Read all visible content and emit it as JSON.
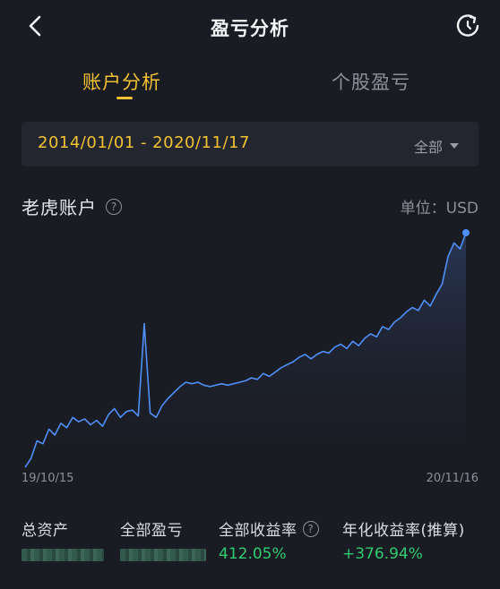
{
  "header": {
    "title": "盈亏分析"
  },
  "tabs": [
    {
      "label": "账户分析",
      "active": true
    },
    {
      "label": "个股盈亏",
      "active": false
    }
  ],
  "date_filter": {
    "range": "2014/01/01 - 2020/11/17",
    "scope": "全部"
  },
  "account": {
    "name": "老虎账户",
    "help_glyph": "?",
    "unit": "单位：USD"
  },
  "chart_data": {
    "type": "line",
    "x_start_label": "19/10/15",
    "x_end_label": "20/11/16",
    "series": [
      {
        "values": [
          0.02,
          0.08,
          0.2,
          0.18,
          0.28,
          0.24,
          0.32,
          0.29,
          0.36,
          0.33,
          0.35,
          0.31,
          0.34,
          0.3,
          0.38,
          0.42,
          0.36,
          0.4,
          0.41,
          0.37,
          1.0,
          0.39,
          0.36,
          0.44,
          0.49,
          0.53,
          0.57,
          0.6,
          0.59,
          0.6,
          0.58,
          0.57,
          0.58,
          0.59,
          0.58,
          0.59,
          0.6,
          0.61,
          0.63,
          0.62,
          0.66,
          0.64,
          0.67,
          0.7,
          0.72,
          0.74,
          0.77,
          0.79,
          0.76,
          0.79,
          0.81,
          0.8,
          0.84,
          0.86,
          0.83,
          0.88,
          0.85,
          0.9,
          0.93,
          0.91,
          0.98,
          0.96,
          1.01,
          1.04,
          1.08,
          1.11,
          1.09,
          1.16,
          1.12,
          1.2,
          1.27,
          1.46,
          1.55,
          1.51,
          1.62
        ]
      }
    ],
    "line_color": "#4f8ff7"
  },
  "stats": [
    {
      "label": "总资产",
      "value": ""
    },
    {
      "label": "全部盈亏",
      "value": ""
    },
    {
      "label": "全部收益率",
      "value": "412.05%",
      "has_help": true
    },
    {
      "label": "年化收益率(推算)",
      "value": "+376.94%"
    }
  ],
  "colors": {
    "background": "#1a1c23",
    "accent": "#f1c232",
    "positive": "#2ecc71",
    "line": "#4f8ff7"
  }
}
